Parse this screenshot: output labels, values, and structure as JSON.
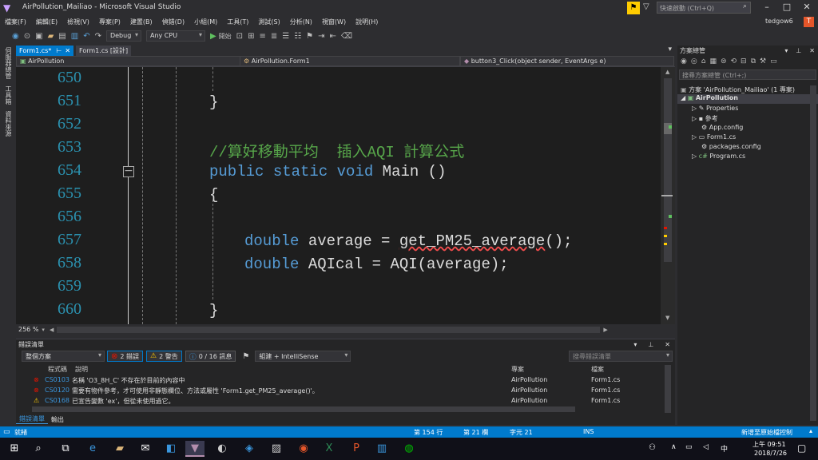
{
  "window": {
    "title": "AirPollution_Mailiao - Microsoft Visual Studio",
    "quick_launch_placeholder": "快速啟動 (Ctrl+Q)",
    "account": "tedgow6",
    "avatar_letter": "T"
  },
  "menu": [
    "檔案(F)",
    "編輯(E)",
    "檢視(V)",
    "專案(P)",
    "建置(B)",
    "偵錯(D)",
    "小組(M)",
    "工具(T)",
    "測試(S)",
    "分析(N)",
    "視窗(W)",
    "說明(H)"
  ],
  "toolbar": {
    "config": "Debug",
    "platform": "Any CPU",
    "start_label": "開始"
  },
  "left_tabs": [
    "伺服器總管",
    "工具箱",
    "資料來源"
  ],
  "doc_tabs": [
    {
      "label": "Form1.cs*",
      "active": true
    },
    {
      "label": "Form1.cs [設計]",
      "active": false
    }
  ],
  "navbar": {
    "project": "AirPollution",
    "class": "AirPollution.Form1",
    "member": "button3_Click(object sender, EventArgs e)"
  },
  "editor": {
    "zoom": "256 %",
    "lines": [
      {
        "num": "650",
        "text": ""
      },
      {
        "num": "651",
        "text": "}"
      },
      {
        "num": "652",
        "text": ""
      },
      {
        "num": "653",
        "text": "//算好移動平均  插入AQI 計算公式"
      },
      {
        "num": "654",
        "text": "public static void  Main ()"
      },
      {
        "num": "655",
        "text": "{"
      },
      {
        "num": "656",
        "text": ""
      },
      {
        "num": "657",
        "text": "double average = get_PM25_average();"
      },
      {
        "num": "658",
        "text": "double AQIcal = AQI(average);"
      },
      {
        "num": "659",
        "text": ""
      },
      {
        "num": "660",
        "text": "}"
      }
    ],
    "kw_public": "public",
    "kw_static": "static",
    "kw_void": "void",
    "main_sig": " Main ()",
    "kw_double": "double",
    "avg_decl": " average = ",
    "avg_call": "get_PM25_average",
    "avg_tail": "();",
    "aqi_decl": " AQIcal = AQI(average);"
  },
  "error_list": {
    "title": "錯誤清單",
    "scope": "整個方案",
    "errors_btn": "2 錯誤",
    "warnings_btn": "2 警告",
    "messages_btn": "0 / 16 訊息",
    "build_filter": "組建 + IntelliSense",
    "search_placeholder": "搜尋錯誤清單",
    "columns": {
      "code": "程式碼",
      "desc": "說明",
      "project": "專案",
      "file": "檔案"
    },
    "rows": [
      {
        "type": "error",
        "code": "CS0103",
        "desc": "名稱 'O3_8H_C' 不存在於目前的內容中",
        "project": "AirPollution",
        "file": "Form1.cs"
      },
      {
        "type": "error",
        "code": "CS0120",
        "desc": "需要有物件參考，才可使用非靜態欄位、方法或屬性 'Form1.get_PM25_average()'。",
        "project": "AirPollution",
        "file": "Form1.cs"
      },
      {
        "type": "warning",
        "code": "CS0168",
        "desc": "已宣告變數 'ex'，但從未使用過它。",
        "project": "AirPollution",
        "file": "Form1.cs"
      }
    ],
    "bottom_tabs": [
      "錯誤清單",
      "輸出"
    ]
  },
  "solution_explorer": {
    "title": "方案總管",
    "search_placeholder": "搜尋方案總管 (Ctrl+;)",
    "solution": "方案 'AirPollution_Mailiao' (1 專案)",
    "project": "AirPollution",
    "items": [
      "Properties",
      "參考",
      "App.config",
      "Form1.cs",
      "packages.config",
      "Program.cs"
    ]
  },
  "status": {
    "ready": "就緒",
    "row": "第 154 行",
    "col": "第 21 欄",
    "char": "字元 21",
    "mode": "INS",
    "source_control": "新增至原始檔控制"
  },
  "taskbar": {
    "time": "上午 09:51",
    "date": "2018/7/26",
    "lang": "中"
  },
  "colors": {
    "accent": "#007acc",
    "keyword": "#569cd6",
    "comment": "#57a64a",
    "linenum": "#2b91af",
    "error": "#e51400",
    "warning": "#ffcc00"
  }
}
